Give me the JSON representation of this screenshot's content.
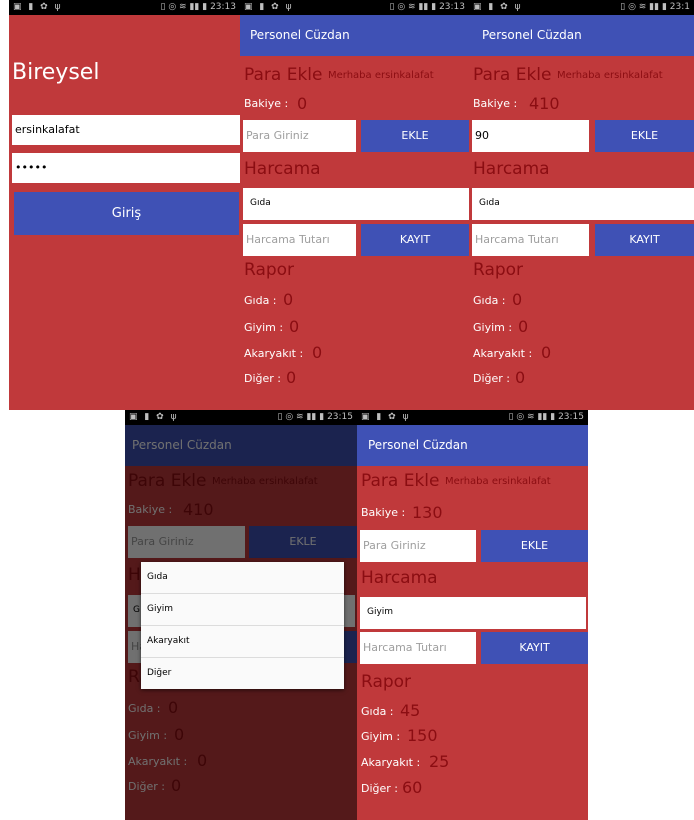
{
  "status_bar": {
    "icons_left": "▣ ▮ ✿ ψ",
    "icons_right": "▯ ◎ ≋ ▮▮ ▮",
    "times": [
      "23:13",
      "23:13",
      "23:1",
      "23:15",
      "23:15"
    ]
  },
  "login": {
    "title": "Bireysel",
    "username": "ersinkalafat",
    "password": "•••••",
    "login_button": "Giriş"
  },
  "app": {
    "title": "Personel Cüzdan",
    "add_money_heading": "Para Ekle",
    "greeting": "Merhaba  ersinkalafat",
    "balance_label": "Bakiye :",
    "amount_placeholder": "Para Giriniz",
    "add_button": "EKLE",
    "spending_heading": "Harcama",
    "spending_amount_placeholder": "Harcama Tutarı",
    "save_button": "KAYIT",
    "report_heading": "Rapor",
    "labels": {
      "food": "Gıda :",
      "clothing": "Giyim :",
      "fuel": "Akaryakıt :",
      "other": "Diğer :"
    }
  },
  "screen2": {
    "balance": "0",
    "category": "Gıda",
    "food": "0",
    "clothing": "0",
    "fuel": "0",
    "other": "0"
  },
  "screen3": {
    "balance": "410",
    "amount": "90",
    "category": "Gıda",
    "food": "0",
    "clothing": "0",
    "fuel": "0",
    "other": "0"
  },
  "screen4": {
    "balance": "410",
    "category_partial": "G",
    "food": "0",
    "clothing": "0",
    "fuel": "0",
    "other": "0",
    "dropdown_options": [
      "Gıda",
      "Giyim",
      "Akaryakıt",
      "Diğer"
    ]
  },
  "screen5": {
    "balance": "130",
    "category": "Giyim",
    "food": "45",
    "clothing": "150",
    "fuel": "25",
    "other": "60"
  },
  "colors": {
    "background": "#c0393b",
    "accent": "#3f51b5",
    "value_text": "#8b0d12"
  }
}
